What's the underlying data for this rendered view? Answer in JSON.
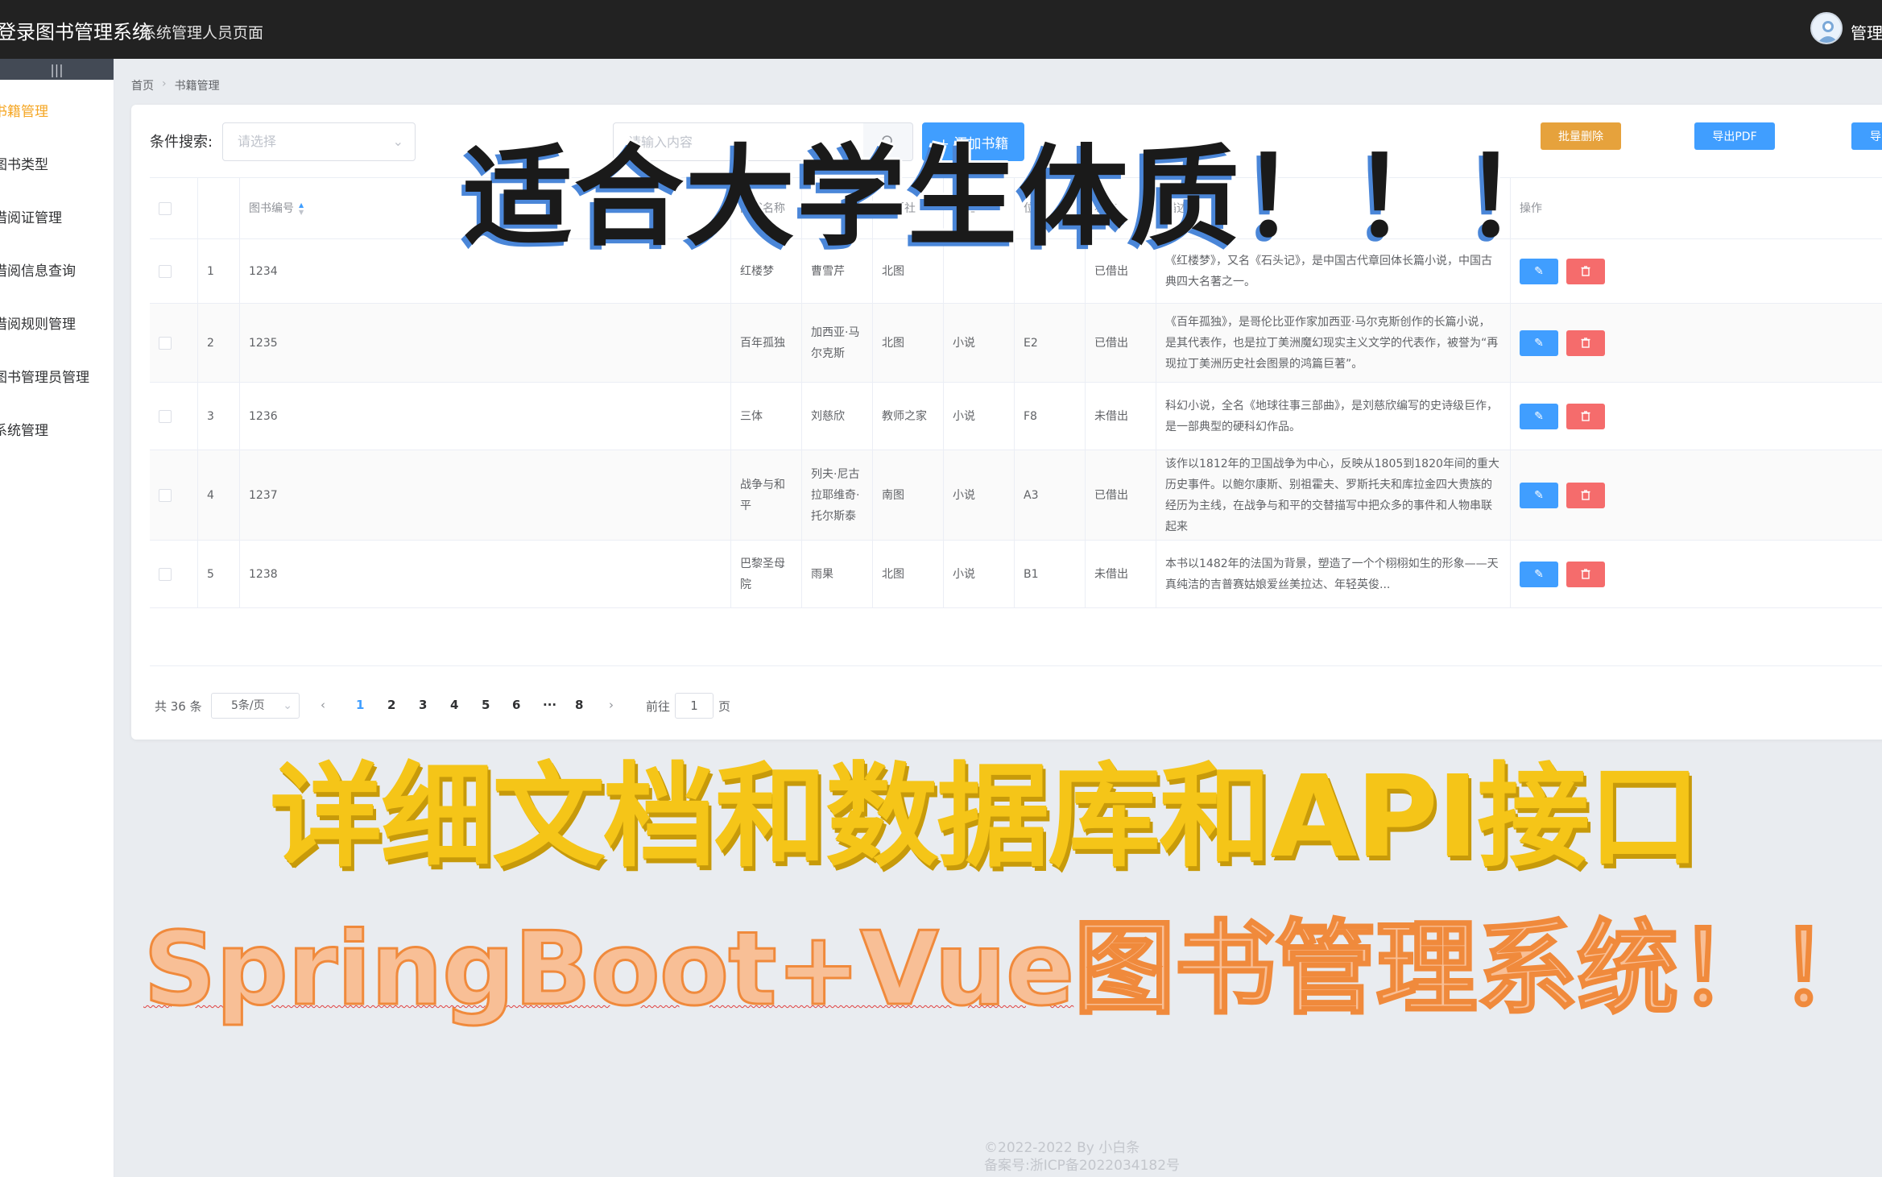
{
  "header": {
    "title": "登录图书管理系统",
    "subtitle": "系统管理人员页面",
    "user": "管理"
  },
  "sidebar": {
    "collapse_icon": "|||",
    "items": [
      {
        "label": "书籍管理",
        "active": true
      },
      {
        "label": "图书类型"
      },
      {
        "label": "借阅证管理"
      },
      {
        "label": "借阅信息查询"
      },
      {
        "label": "借阅规则管理"
      },
      {
        "label": "图书管理员管理"
      },
      {
        "label": "系统管理"
      }
    ]
  },
  "breadcrumb": [
    "首页",
    "书籍管理"
  ],
  "toolbar": {
    "search_label": "条件搜索:",
    "select_placeholder": "请选择",
    "input_placeholder": "请输入内容",
    "add_label": "+ 添加书籍",
    "batch_delete_label": "批量删除",
    "export_pdf_label": "导出PDF",
    "export_more_label": "导"
  },
  "table": {
    "columns": [
      "",
      "",
      "图书编号",
      "图书名称",
      "作者",
      "出版社",
      "类型",
      "位置",
      "状态",
      "描述",
      "操作"
    ],
    "rows": [
      {
        "index": "1",
        "id": "1234",
        "name": "红楼梦",
        "author": "曹雪芹",
        "publisher": "北图",
        "type": "",
        "loc": "",
        "status": "已借出",
        "desc": "《红楼梦》，又名《石头记》，是中国古代章回体长篇小说，中国古典四大名著之一。"
      },
      {
        "index": "2",
        "id": "1235",
        "name": "百年孤独",
        "author": "加西亚·马尔克斯",
        "publisher": "北图",
        "type": "小说",
        "loc": "E2",
        "status": "已借出",
        "desc": "《百年孤独》，是哥伦比亚作家加西亚·马尔克斯创作的长篇小说，是其代表作，也是拉丁美洲魔幻现实主义文学的代表作，被誉为“再现拉丁美洲历史社会图景的鸿篇巨著”。"
      },
      {
        "index": "3",
        "id": "1236",
        "name": "三体",
        "author": "刘慈欣",
        "publisher": "教师之家",
        "type": "小说",
        "loc": "F8",
        "status": "未借出",
        "desc": "科幻小说，全名《地球往事三部曲》，是刘慈欣编写的史诗级巨作，是一部典型的硬科幻作品。"
      },
      {
        "index": "4",
        "id": "1237",
        "name": "战争与和平",
        "author": "列夫·尼古拉耶维奇·托尔斯泰",
        "publisher": "南图",
        "type": "小说",
        "loc": "A3",
        "status": "已借出",
        "desc": "该作以1812年的卫国战争为中心，反映从1805到1820年间的重大历史事件。以鲍尔康斯、别祖霍夫、罗斯托夫和库拉金四大贵族的经历为主线，在战争与和平的交替描写中把众多的事件和人物串联起来"
      },
      {
        "index": "5",
        "id": "1238",
        "name": "巴黎圣母院",
        "author": "雨果",
        "publisher": "北图",
        "type": "小说",
        "loc": "B1",
        "status": "未借出",
        "desc": "本书以1482年的法国为背景，塑造了一个个栩栩如生的形象——天真纯洁的吉普赛姑娘爱丝美拉达、年轻英俊..."
      }
    ]
  },
  "pagination": {
    "total": "共 36 条",
    "page_size": "5条/页",
    "pages": [
      "1",
      "2",
      "3",
      "4",
      "5",
      "6",
      "···",
      "8"
    ],
    "goto_label": "前往",
    "goto_value": "1",
    "page_suffix": "页"
  },
  "overlay": {
    "line1": "适合大学生体质！！！",
    "line2": "详细文档和数据库和API接口",
    "line3_a": "SpringBoot+Vue",
    "line3_b": "图书管理系统！！"
  },
  "footer": {
    "copyright": "©2022-2022 By 小白条",
    "icp": "备案号:浙ICP备2022034182号"
  },
  "colors": {
    "primary": "#409eff",
    "danger": "#f56c6c",
    "warning": "#e6a23c",
    "active_menu": "#f5a623",
    "header_bg": "#222222"
  }
}
